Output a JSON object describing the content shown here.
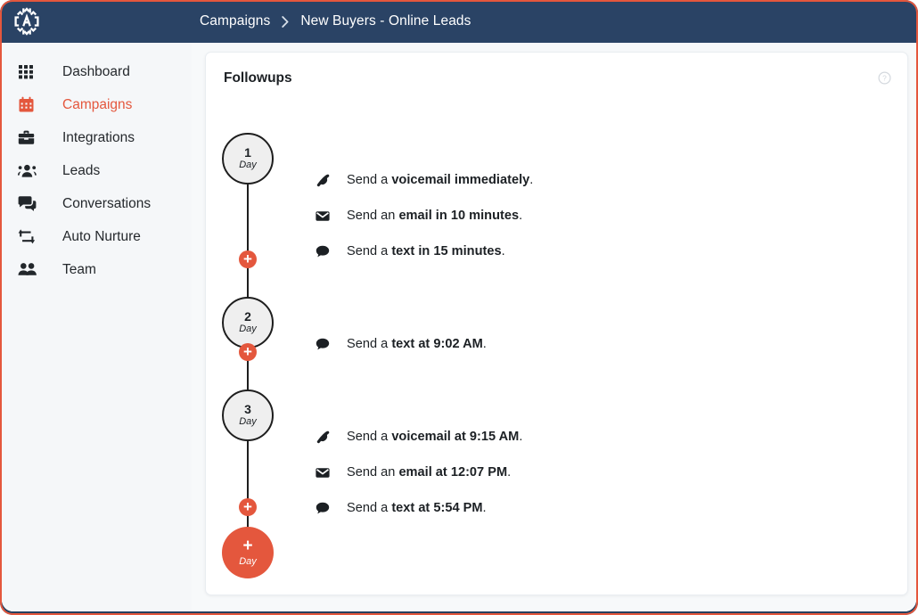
{
  "app": {
    "logo_name": "appointments-logo",
    "frame_color": "#2A4365",
    "accent_color": "#E4573D"
  },
  "topbar": {
    "breadcrumb": [
      {
        "label": "Campaigns",
        "name": "breadcrumb-campaigns"
      },
      {
        "label": "New Buyers - Online Leads",
        "name": "breadcrumb-current"
      }
    ],
    "separator": "›"
  },
  "sidebar": {
    "items": [
      {
        "label": "Dashboard",
        "icon": "grid-icon",
        "active": false
      },
      {
        "label": "Campaigns",
        "icon": "calendar-icon",
        "active": true
      },
      {
        "label": "Integrations",
        "icon": "toolbox-icon",
        "active": false
      },
      {
        "label": "Leads",
        "icon": "users-group-icon",
        "active": false
      },
      {
        "label": "Conversations",
        "icon": "chat-bubbles-icon",
        "active": false
      },
      {
        "label": "Auto Nurture",
        "icon": "repeat-icon",
        "active": false
      },
      {
        "label": "Team",
        "icon": "people-icon",
        "active": false
      }
    ]
  },
  "card": {
    "title": "Followups",
    "help_icon": "help-circle-icon",
    "day_word": "Day",
    "add_day_symbol": "+",
    "days": [
      {
        "number": "1",
        "word": "Day"
      },
      {
        "number": "2",
        "word": "Day"
      },
      {
        "number": "3",
        "word": "Day"
      }
    ],
    "actions": [
      {
        "icon": "phone-icon",
        "prefix": "Send a ",
        "bold": "voicemail immediately",
        "suffix": "."
      },
      {
        "icon": "envelope-icon",
        "prefix": "Send an ",
        "bold": "email in 10 minutes",
        "suffix": "."
      },
      {
        "icon": "chat-bubble-icon",
        "prefix": "Send a ",
        "bold": "text in 15 minutes",
        "suffix": "."
      },
      {
        "icon": "chat-bubble-icon",
        "prefix": "Send a ",
        "bold": "text at 9:02 AM",
        "suffix": "."
      },
      {
        "icon": "phone-icon",
        "prefix": "Send a ",
        "bold": "voicemail at 9:15 AM",
        "suffix": "."
      },
      {
        "icon": "envelope-icon",
        "prefix": "Send an ",
        "bold": "email at 12:07 PM",
        "suffix": "."
      },
      {
        "icon": "chat-bubble-icon",
        "prefix": "Send a ",
        "bold": "text at 5:54 PM",
        "suffix": "."
      }
    ]
  }
}
